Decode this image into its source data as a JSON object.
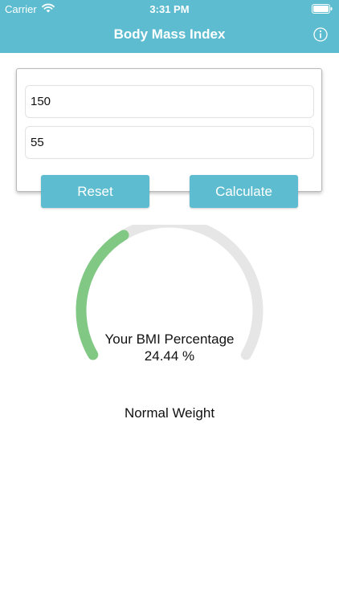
{
  "status_bar": {
    "carrier": "Carrier",
    "time": "3:31 PM",
    "icons": [
      "wifi-icon",
      "battery-icon"
    ]
  },
  "nav": {
    "title": "Body Mass Index",
    "info_icon": "info-icon"
  },
  "form": {
    "height_value": "150",
    "weight_value": "55"
  },
  "buttons": {
    "reset_label": "Reset",
    "calculate_label": "Calculate"
  },
  "result": {
    "label": "Your BMI Percentage",
    "value_text": "24.44 %",
    "category": "Normal Weight",
    "gauge_fraction": 0.37
  },
  "colors": {
    "accent": "#5dbccf",
    "gauge_fill": "#80c883",
    "gauge_track": "#e6e6e6"
  }
}
